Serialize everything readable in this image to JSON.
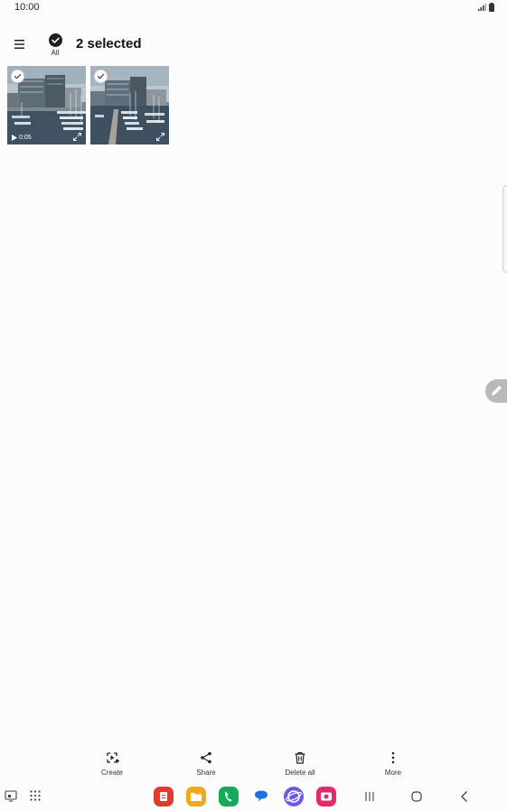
{
  "status_bar": {
    "time": "10:00"
  },
  "toolbar": {
    "select_all_label": "All",
    "selected_text": "2 selected"
  },
  "thumbnails": [
    {
      "duration": "0:05",
      "is_video": true,
      "selected": true
    },
    {
      "duration": "",
      "is_video": false,
      "selected": true
    }
  ],
  "actions": {
    "create": "Create",
    "share": "Share",
    "delete_all": "Delete all",
    "more": "More"
  },
  "dock": {
    "apps": [
      {
        "icon": "notes-app-icon",
        "color": "#e03b2f"
      },
      {
        "icon": "my-files-app-icon",
        "color": "#f0a81c"
      },
      {
        "icon": "phone-app-icon",
        "color": "#17a957"
      },
      {
        "icon": "messages-app-icon",
        "color": "#1f6fe0"
      },
      {
        "icon": "internet-app-icon",
        "color": "#6b5be0"
      },
      {
        "icon": "camera-app-icon",
        "color": "#e02a6a"
      }
    ]
  }
}
